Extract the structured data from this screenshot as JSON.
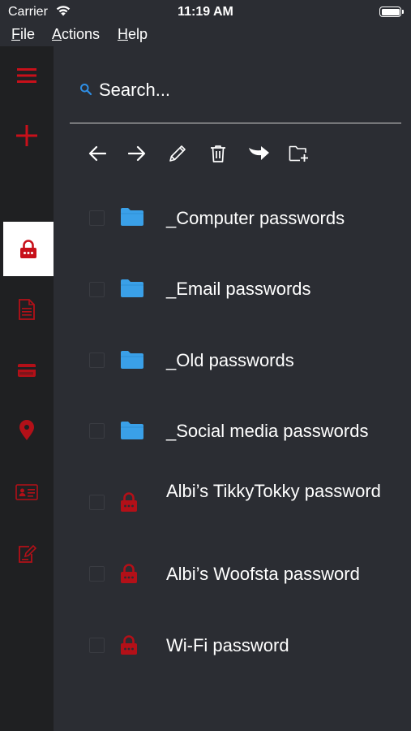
{
  "status": {
    "carrier": "Carrier",
    "time": "11:19 AM"
  },
  "menu": {
    "file": "File",
    "actions": "Actions",
    "help": "Help"
  },
  "search": {
    "placeholder": "Search..."
  },
  "toolbar": {
    "icons": [
      "arrow-left-icon",
      "arrow-right-icon",
      "pencil-icon",
      "trash-icon",
      "move-icon",
      "new-folder-icon"
    ]
  },
  "sidebar": {
    "selected": "passwords",
    "icons": [
      "menu-icon",
      "add-icon",
      "lock-icon",
      "document-icon",
      "credit-card-icon",
      "location-pin-icon",
      "contact-card-icon",
      "note-icon"
    ]
  },
  "items": [
    {
      "type": "folder",
      "label": "_Computer passwords"
    },
    {
      "type": "folder",
      "label": "_Email passwords"
    },
    {
      "type": "folder",
      "label": "_Old passwords"
    },
    {
      "type": "folder",
      "label": "_Social media passwords"
    },
    {
      "type": "password",
      "label": "Albi’s TikkyTokky password"
    },
    {
      "type": "password",
      "label": "Albi’s Woofsta password"
    },
    {
      "type": "password",
      "label": "Wi-Fi password"
    }
  ],
  "colors": {
    "accent": "#c8101a",
    "folder": "#3aa0e8",
    "background": "#2b2d33",
    "sidebar": "#1f2022"
  }
}
